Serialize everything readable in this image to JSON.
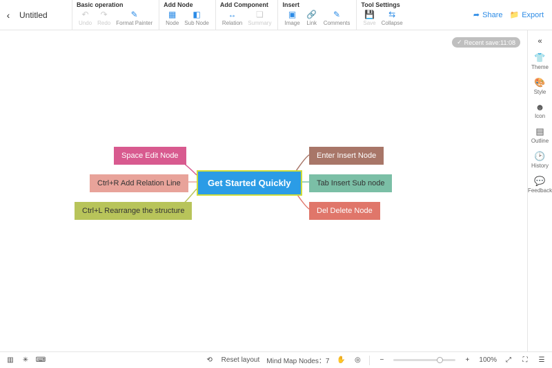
{
  "header": {
    "title": "Untitled",
    "groups": {
      "basic": {
        "label": "Basic operation",
        "undo": "Undo",
        "redo": "Redo",
        "format_painter": "Format Painter"
      },
      "add_node": {
        "label": "Add Node",
        "node": "Node",
        "sub_node": "Sub Node"
      },
      "add_component": {
        "label": "Add Component",
        "relation": "Relation",
        "summary": "Summary"
      },
      "insert": {
        "label": "Insert",
        "image": "Image",
        "link": "Link",
        "comments": "Comments"
      },
      "tool_settings": {
        "label": "Tool Settings",
        "save": "Save",
        "collapse": "Collapse"
      }
    },
    "share": "Share",
    "export": "Export"
  },
  "autosave": "Recent save:11:08",
  "mindmap": {
    "center": "Get Started Quickly",
    "left": [
      {
        "text": "Space Edit Node",
        "bg": "#d85a8f"
      },
      {
        "text": "Ctrl+R Add Relation Line",
        "bg": "#e8a39a"
      },
      {
        "text": "Ctrl+L Rearrange the structure",
        "bg": "#b8c45a"
      }
    ],
    "right": [
      {
        "text": "Enter Insert Node",
        "bg": "#a87668"
      },
      {
        "text": "Tab Insert Sub node",
        "bg": "#7bbfa6"
      },
      {
        "text": "Del Delete Node",
        "bg": "#e0766a"
      }
    ]
  },
  "rightbar": {
    "theme": "Theme",
    "style": "Style",
    "icon": "Icon",
    "outline": "Outline",
    "history": "History",
    "feedback": "Feedback"
  },
  "statusbar": {
    "reset": "Reset layout",
    "nodes_label": "Mind Map Nodes：",
    "nodes_count": "7",
    "zoom": "100%"
  }
}
